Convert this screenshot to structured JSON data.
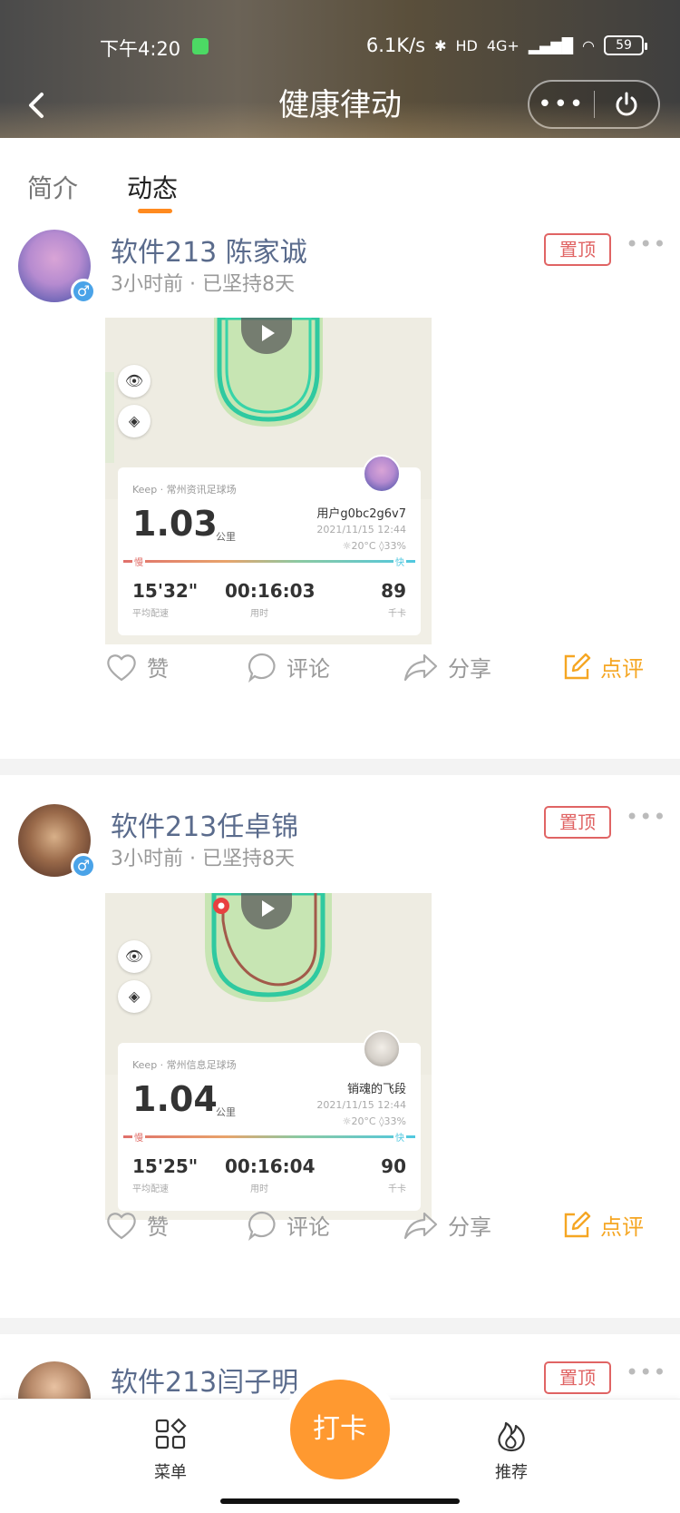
{
  "status_bar": {
    "time": "下午4:20",
    "network_speed": "6.1K/s",
    "network_type": "4G+",
    "hd": "HD",
    "battery": "59"
  },
  "header": {
    "title": "健康律动",
    "more_label": "•••"
  },
  "tabs": [
    {
      "label": "简介",
      "active": false
    },
    {
      "label": "动态",
      "active": true
    }
  ],
  "posts": [
    {
      "name": "软件213 陈家诚",
      "time": "3小时前",
      "separator": "·",
      "streak": "已坚持8天",
      "pin": "置顶",
      "more": "•••",
      "card": {
        "source": "Keep · 常州资讯足球场",
        "distance": "1.03",
        "distance_unit": "公里",
        "user": "用户g0bc2g6v7",
        "date": "2021/11/15 12:44",
        "weather": "☼20°C ◊33%",
        "slow": "慢",
        "fast": "快",
        "pace": "15'32\"",
        "pace_label": "平均配速",
        "duration": "00:16:03",
        "duration_label": "用时",
        "calories": "89",
        "calories_label": "千卡"
      },
      "actions": {
        "like": "赞",
        "comment": "评论",
        "share": "分享",
        "review": "点评"
      }
    },
    {
      "name": "软件213任卓锦",
      "time": "3小时前",
      "separator": "·",
      "streak": "已坚持8天",
      "pin": "置顶",
      "more": "•••",
      "card": {
        "source": "Keep · 常州信息足球场",
        "distance": "1.04",
        "distance_unit": "公里",
        "user": "销魂的飞段",
        "date": "2021/11/15 12:44",
        "weather": "☼20°C ◊33%",
        "slow": "慢",
        "fast": "快",
        "pace": "15'25\"",
        "pace_label": "平均配速",
        "duration": "00:16:04",
        "duration_label": "用时",
        "calories": "90",
        "calories_label": "千卡"
      },
      "actions": {
        "like": "赞",
        "comment": "评论",
        "share": "分享",
        "review": "点评"
      }
    },
    {
      "name": "软件213闫子明",
      "pin": "置顶",
      "more": "•••"
    }
  ],
  "bottom_nav": {
    "menu": "菜单",
    "checkin": "打卡",
    "recommend": "推荐"
  },
  "colors": {
    "accent": "#ff9930",
    "pin": "#e06464",
    "review": "#f5a623",
    "name": "#5a6b8c",
    "gender": "#4aa3e8"
  },
  "icons": [
    "back-icon",
    "more-icon",
    "power-icon",
    "eye-icon",
    "layers-icon",
    "play-icon",
    "heart-icon",
    "comment-icon",
    "share-icon",
    "edit-icon",
    "menu-grid-icon",
    "fire-icon",
    "male-icon"
  ]
}
